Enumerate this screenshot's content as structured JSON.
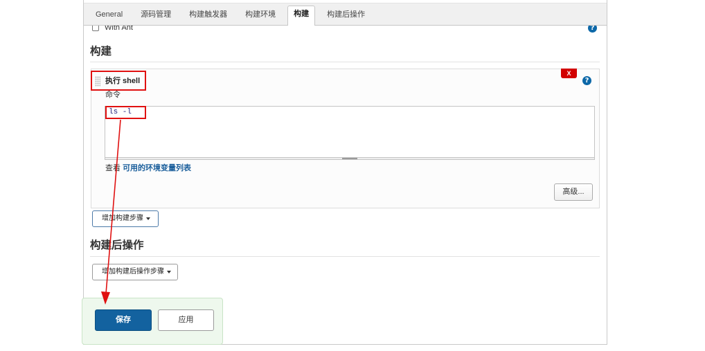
{
  "tabs": [
    {
      "label": "General",
      "active": false
    },
    {
      "label": "源码管理",
      "active": false
    },
    {
      "label": "构建触发器",
      "active": false
    },
    {
      "label": "构建环境",
      "active": false
    },
    {
      "label": "构建",
      "active": true
    },
    {
      "label": "构建后操作",
      "active": false
    }
  ],
  "build_environment": {
    "with_ant": {
      "label": "With Ant",
      "checked": false
    }
  },
  "build": {
    "title": "构建",
    "step": {
      "title": "执行 shell",
      "delete_label": "X",
      "command_label": "命令",
      "command": "ls -l",
      "env_hint_prefix": "查看",
      "env_hint_link": "可用的环境变量列表",
      "advanced_label": "高级..."
    },
    "add_step_label": "增加构建步骤"
  },
  "post_build": {
    "title": "构建后操作",
    "add_step_label": "增加构建后操作步骤"
  },
  "footer": {
    "save_label": "保存",
    "apply_label": "应用"
  },
  "icons": {
    "help": {
      "name": "help-icon",
      "glyph": "?"
    },
    "dropdown": "caret-down-icon",
    "drag": "drag-handle-icon",
    "annotation_arrow": "arrow-down-icon"
  },
  "colors": {
    "accent": "#13629f",
    "link": "#1a5e9b",
    "help_icon": "#0d68a8",
    "danger": "#d20000",
    "annotation": "#e01010",
    "footer_bg": "#eef8ed",
    "footer_border": "#c9e4c6",
    "command_text": "#24247e"
  }
}
